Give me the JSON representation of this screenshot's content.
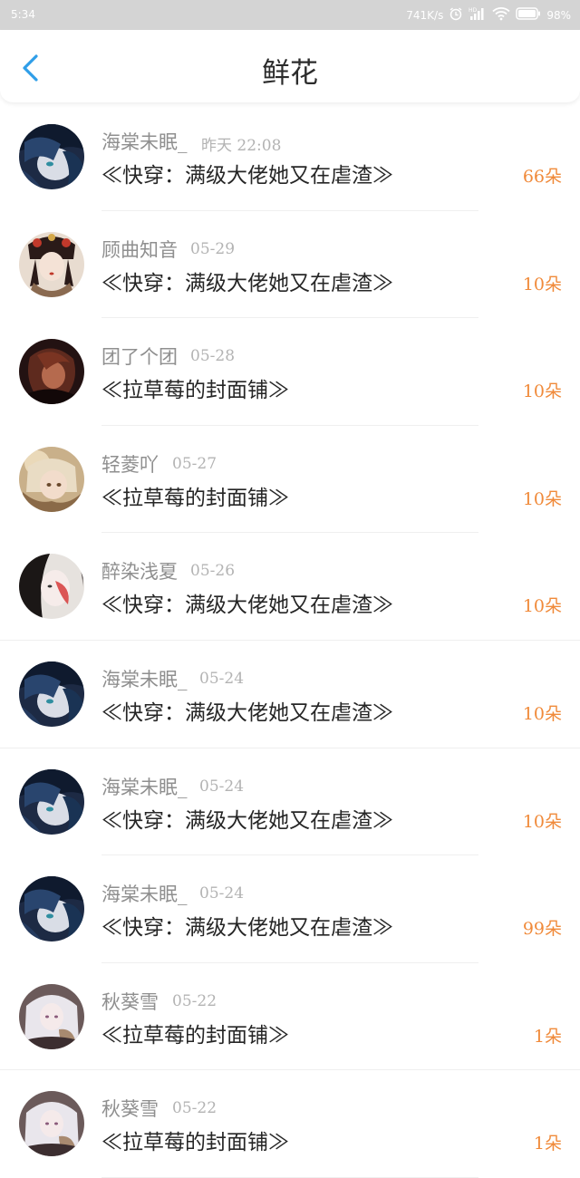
{
  "status_bar": {
    "time": "5:34",
    "network_speed": "741K/s",
    "battery": "98%",
    "icons": [
      "alarm-icon",
      "hd-signal-icon",
      "wifi-icon",
      "battery-icon"
    ]
  },
  "header": {
    "title": "鲜花",
    "back_icon": "chevron-left-icon"
  },
  "colors": {
    "accent": "#2f9ee8",
    "count": "#f08a3a",
    "name": "#8f8f8f",
    "date": "#b3b3b3",
    "book": "#262626"
  },
  "items": [
    {
      "name": "海棠未眠_",
      "date": "昨天 22:08",
      "book": "≪快穿：满级大佬她又在虐渣≫",
      "count": "66朵",
      "avatar": "dark-blue-hair-avatar"
    },
    {
      "name": "顾曲知音",
      "date": "05-29",
      "book": "≪快穿：满级大佬她又在虐渣≫",
      "count": "10朵",
      "avatar": "traditional-headdress-avatar"
    },
    {
      "name": "团了个团",
      "date": "05-28",
      "book": "≪拉草莓的封面铺≫",
      "count": "10朵",
      "avatar": "dark-red-avatar"
    },
    {
      "name": "轻菱吖",
      "date": "05-27",
      "book": "≪拉草莓的封面铺≫",
      "count": "10朵",
      "avatar": "golden-light-avatar"
    },
    {
      "name": "醉染浅夏",
      "date": "05-26",
      "book": "≪快穿：满级大佬她又在虐渣≫",
      "count": "10朵",
      "avatar": "red-face-avatar"
    },
    {
      "name": "海棠未眠_",
      "date": "05-24",
      "book": "≪快穿：满级大佬她又在虐渣≫",
      "count": "10朵",
      "avatar": "dark-blue-hair-avatar"
    },
    {
      "name": "海棠未眠_",
      "date": "05-24",
      "book": "≪快穿：满级大佬她又在虐渣≫",
      "count": "10朵",
      "avatar": "dark-blue-hair-avatar"
    },
    {
      "name": "海棠未眠_",
      "date": "05-24",
      "book": "≪快穿：满级大佬她又在虐渣≫",
      "count": "99朵",
      "avatar": "dark-blue-hair-avatar"
    },
    {
      "name": "秋葵雪",
      "date": "05-22",
      "book": "≪拉草莓的封面铺≫",
      "count": "1朵",
      "avatar": "white-hair-avatar"
    },
    {
      "name": "秋葵雪",
      "date": "05-22",
      "book": "≪拉草莓的封面铺≫",
      "count": "1朵",
      "avatar": "white-hair-avatar"
    }
  ]
}
